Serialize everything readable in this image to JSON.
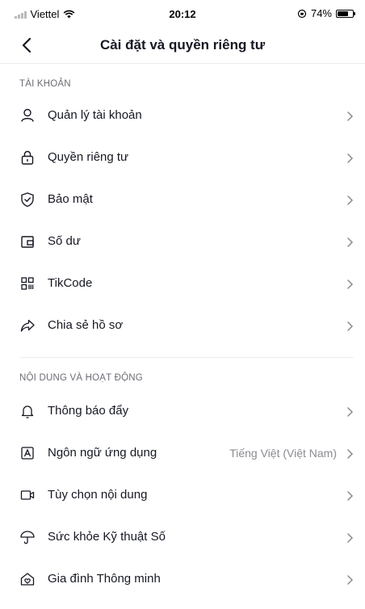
{
  "status_bar": {
    "carrier": "Viettel",
    "time": "20:12",
    "battery": "74%",
    "battery_level": 0.74
  },
  "header": {
    "title": "Cài đặt và quyền riêng tư",
    "back_icon": "chevron-left-icon"
  },
  "sections": [
    {
      "title": "TÀI KHOẢN",
      "items": [
        {
          "label": "Quản lý tài khoản",
          "icon": "person-icon"
        },
        {
          "label": "Quyền riêng tư",
          "icon": "lock-icon"
        },
        {
          "label": "Bảo mật",
          "icon": "shield-icon"
        },
        {
          "label": "Số dư",
          "icon": "wallet-icon"
        },
        {
          "label": "TikCode",
          "icon": "qr-code-icon"
        },
        {
          "label": "Chia sẻ hồ sơ",
          "icon": "share-icon"
        }
      ]
    },
    {
      "title": "NỘI DUNG VÀ HOẠT ĐỘNG",
      "items": [
        {
          "label": "Thông báo đẩy",
          "icon": "bell-icon"
        },
        {
          "label": "Ngôn ngữ ứng dụng",
          "icon": "language-icon",
          "value": "Tiếng Việt (Việt Nam)"
        },
        {
          "label": "Tùy chọn nội dung",
          "icon": "video-icon"
        },
        {
          "label": "Sức khỏe Kỹ thuật Số",
          "icon": "umbrella-icon"
        },
        {
          "label": "Gia đình Thông minh",
          "icon": "family-home-icon"
        }
      ]
    }
  ],
  "colors": {
    "text": "#161823",
    "secondary": "#8a8b91",
    "section_title": "#6b6d74",
    "divider": "#ececec"
  }
}
